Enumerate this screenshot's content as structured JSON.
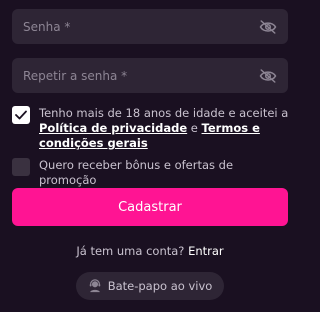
{
  "form": {
    "password": {
      "placeholder": "Senha *",
      "value": ""
    },
    "repeat_password": {
      "placeholder": "Repetir a senha *",
      "value": ""
    },
    "toggle_visibility_icon": "eye-off-icon",
    "terms": {
      "checked": true,
      "text_before": "Tenho mais de 18 anos de idade e aceitei a ",
      "privacy_link": "Política de privacidade",
      "and_text": " e ",
      "terms_link": "Termos e condições gerais"
    },
    "promo": {
      "checked": false,
      "text": "Quero receber bônus e ofertas de promoção"
    },
    "submit_label": "Cadastrar"
  },
  "login": {
    "question": "Já tem uma conta? ",
    "link": "Entrar"
  },
  "chat": {
    "label": "Bate-papo ao vivo",
    "icon": "support-agent-icon"
  },
  "colors": {
    "background": "#1a1021",
    "field_bg": "#2e2535",
    "accent": "#ff1493"
  }
}
